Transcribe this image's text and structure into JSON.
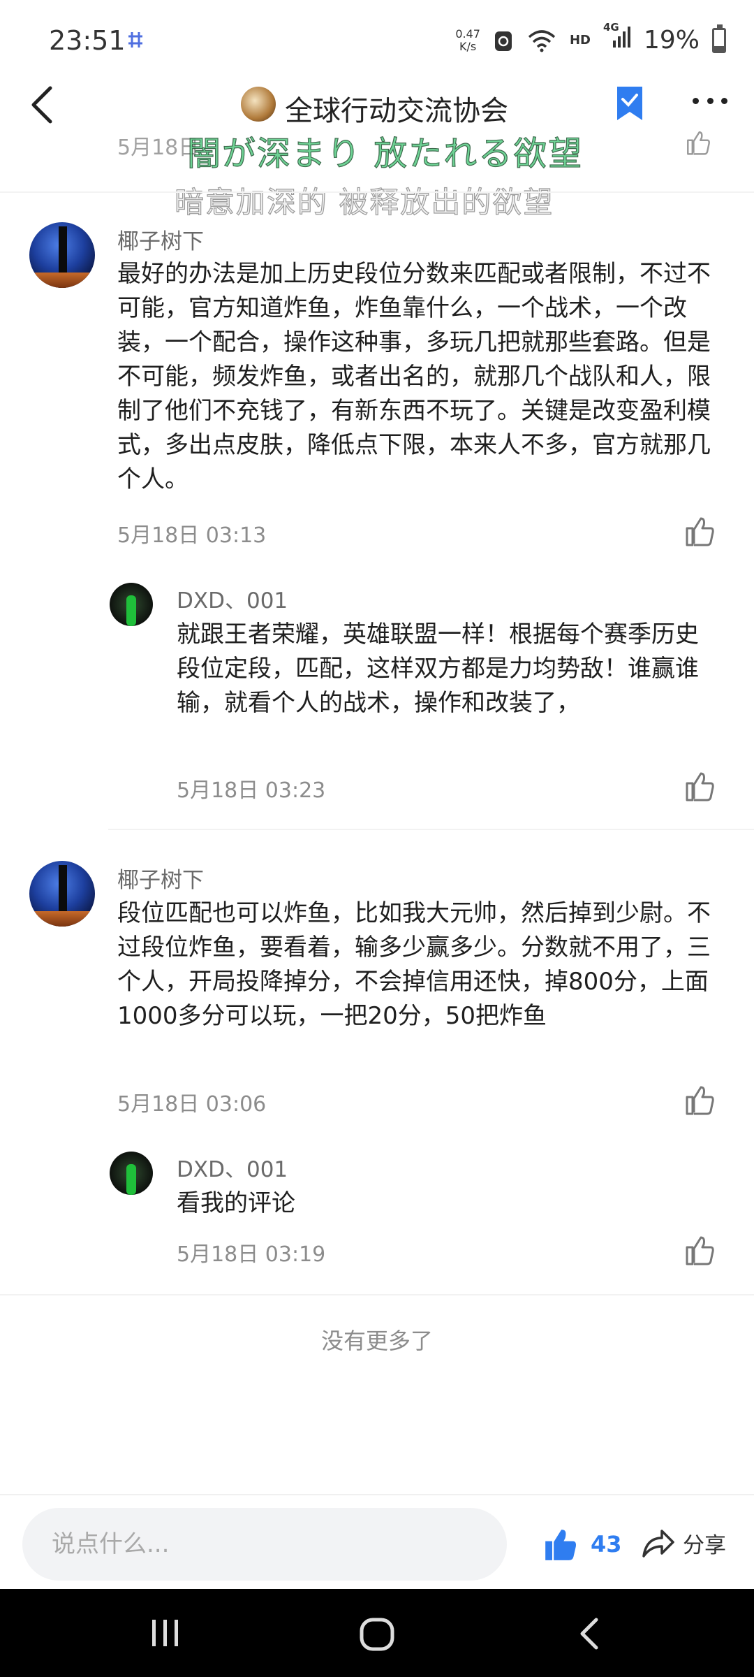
{
  "status_bar": {
    "time": "23:51",
    "net_speed_value": "0.47",
    "net_speed_unit": "K/s",
    "hd": "HD",
    "network": "4G",
    "battery": "19%",
    "battery_level": 0.19
  },
  "header": {
    "title": "全球行动交流协会",
    "icons": [
      "back-icon",
      "group-avatar",
      "bookmark-check-icon",
      "more-icon"
    ]
  },
  "lyrics": {
    "japanese": "闇が深まり 放たれる欲望",
    "chinese": "暗意加深的 被释放出的欲望"
  },
  "partial_timestamp": "5月18日",
  "comments": [
    {
      "username": "椰子树下",
      "text": "最好的办法是加上历史段位分数来匹配或者限制，不过不可能，官方知道炸鱼，炸鱼靠什么，一个战术，一个改装，一个配合，操作这种事，多玩几把就那些套路。但是不可能，频发炸鱼，或者出名的，就那几个战队和人，限制了他们不充钱了，有新东西不玩了。关键是改变盈利模式，多出点皮肤，降低点下限，本来人不多，官方就那几个人。",
      "time": "5月18日 03:13",
      "reply": {
        "username": "DXD、001",
        "text": "就跟王者荣耀，英雄联盟一样！根据每个赛季历史段位定段，匹配，这样双方都是力均势敌！谁赢谁输，就看个人的战术，操作和改装了，",
        "time": "5月18日 03:23"
      }
    },
    {
      "username": "椰子树下",
      "text": "段位匹配也可以炸鱼，比如我大元帅，然后掉到少尉。不过段位炸鱼，要看着，输多少赢多少。分数就不用了，三个人，开局投降掉分，不会掉信用还快，掉800分，上面1000多分可以玩，一把20分，50把炸鱼",
      "time": "5月18日 03:06",
      "reply": {
        "username": "DXD、001",
        "text": "看我的评论",
        "time": "5月18日 03:19"
      }
    }
  ],
  "footer_text": "没有更多了",
  "bottom_bar": {
    "input_placeholder": "说点什么...",
    "like_count": "43",
    "share_label": "分享",
    "accent": "#2f7df0"
  },
  "nav_bar": {
    "icons": [
      "recent-apps-icon",
      "home-icon",
      "back-nav-icon"
    ]
  }
}
